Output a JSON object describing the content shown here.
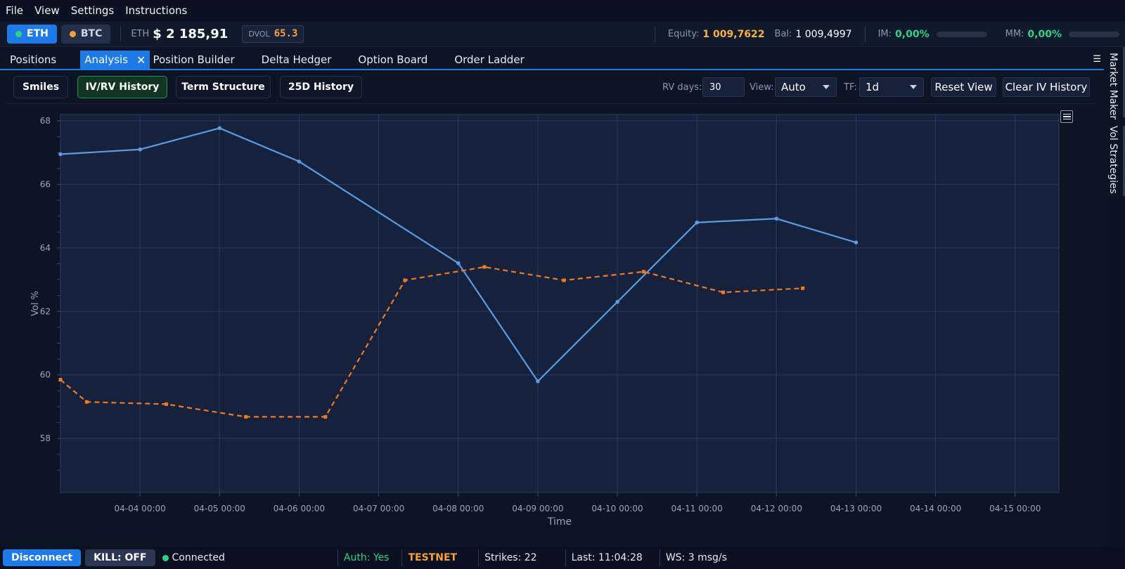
{
  "menubar": {
    "items": [
      "File",
      "View",
      "Settings",
      "Instructions"
    ]
  },
  "topbar": {
    "eth_label": "ETH",
    "btc_label": "BTC",
    "price_label": "ETH",
    "price_value": "$ 2 185,91",
    "dvol_label": "DVOL",
    "dvol_value": "65.3",
    "equity_label": "Equity:",
    "equity_value": "1 009,7622",
    "bal_label": "Bal:",
    "bal_value": "1 009,4997",
    "im_label": "IM:",
    "im_value": "0,00%",
    "mm_label": "MM:",
    "mm_value": "0,00%"
  },
  "tabs": [
    "Positions",
    "Analysis",
    "Position Builder",
    "Delta Hedger",
    "Option Board",
    "Order Ladder"
  ],
  "side_tabs": [
    "Market Maker",
    "Vol Strategies"
  ],
  "toolbar": {
    "buttons": [
      "Smiles",
      "IV/RV History",
      "Term Structure",
      "25D History"
    ],
    "rv_days_label": "RV days:",
    "rv_days_value": "30",
    "view_label": "View:",
    "view_value": "Auto",
    "tf_label": "TF:",
    "tf_value": "1d",
    "reset_label": "Reset View",
    "clear_label": "Clear IV History"
  },
  "chart_data": {
    "type": "line",
    "xlabel": "Time",
    "ylabel": "Vol %",
    "x_ticks": [
      "04-04 00:00",
      "04-05 00:00",
      "04-06 00:00",
      "04-07 00:00",
      "04-08 00:00",
      "04-09 00:00",
      "04-10 00:00",
      "04-11 00:00",
      "04-12 00:00",
      "04-13 00:00",
      "04-14 00:00",
      "04-15 00:00"
    ],
    "y_ticks": [
      58,
      60,
      62,
      64,
      66,
      68
    ],
    "xlim_days": [
      3.0,
      15.55
    ],
    "ylim": [
      56.3,
      68.2
    ],
    "grid": true,
    "series": [
      {
        "color": "#5b9be0",
        "dashed": false,
        "points": [
          [
            3.0,
            66.95
          ],
          [
            4.0,
            67.1
          ],
          [
            5.0,
            67.77
          ],
          [
            6.0,
            66.72
          ],
          [
            8.0,
            63.52
          ],
          [
            9.0,
            59.8
          ],
          [
            10.0,
            62.3
          ],
          [
            11.0,
            64.8
          ],
          [
            12.0,
            64.92
          ],
          [
            13.0,
            64.17
          ]
        ]
      },
      {
        "color": "#f07a22",
        "dashed": true,
        "points": [
          [
            3.0,
            59.85
          ],
          [
            3.33,
            59.15
          ],
          [
            4.33,
            59.08
          ],
          [
            5.33,
            58.68
          ],
          [
            6.33,
            58.68
          ],
          [
            7.33,
            62.98
          ],
          [
            8.33,
            63.4
          ],
          [
            9.33,
            62.98
          ],
          [
            10.33,
            63.25
          ],
          [
            11.33,
            62.6
          ],
          [
            12.33,
            62.73
          ]
        ]
      }
    ]
  },
  "status": {
    "disconnect_label": "Disconnect",
    "kill_label": "KILL: OFF",
    "connected_label": "Connected",
    "auth_label": "Auth: Yes",
    "net_label": "TESTNET",
    "strikes_label": "Strikes: 22",
    "last_label": "Last: 11:04:28",
    "ws_label": "WS: 3 msg/s"
  },
  "colors": {
    "accent": "#1e7ae6",
    "green": "#2fd28a",
    "amber": "#f6b23c",
    "orange": "#f6a03c"
  }
}
